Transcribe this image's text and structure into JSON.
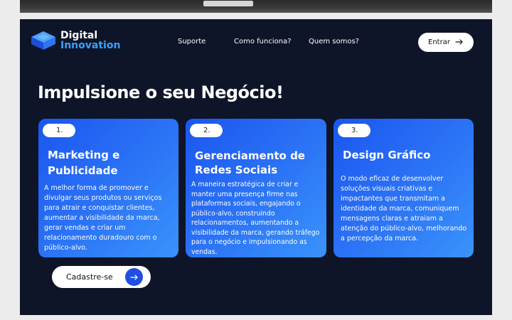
{
  "brand": {
    "line1": "Digital",
    "line2": "Innovation"
  },
  "nav": {
    "suporte": "Suporte",
    "como": "Como funciona?",
    "quem": "Quem somos?"
  },
  "header": {
    "login_label": "Entrar"
  },
  "hero": {
    "title": "Impulsione o seu Negócio!"
  },
  "cards": [
    {
      "number": "1.",
      "title": "Marketing e Publicidade",
      "text": "A melhor forma de promover e divulgar seus produtos ou serviços para atrair e conquistar clientes, aumentar a visibilidade da marca, gerar vendas e criar um relacionamento duradouro com o público-alvo."
    },
    {
      "number": "2.",
      "title": "Gerenciamento de Redes Sociais",
      "text": "A maneira estratégica de criar e manter uma presença firme nas plataformas sociais, engajando o público-alvo, construindo relacionamentos, aumentando a visibilidade da marca, gerando tráfego para o negócio e impulsionando as vendas."
    },
    {
      "number": "3.",
      "title": "Design Gráfico",
      "text": "O modo eficaz de desenvolver soluções visuais criativas e impactantes que transmitam a identidade da marca, comuniquem mensagens claras e atraiam a atenção do público-alvo, melhorando a percepção da marca."
    }
  ],
  "cta": {
    "signup_label": "Cadastre-se"
  },
  "colors": {
    "background": "#0e1528",
    "accent": "#36a2ff",
    "card_start": "#1b56f0",
    "card_end": "#3a93fb",
    "button_circle": "#1f4fe0"
  },
  "icons": {
    "logo": "cube-logo-icon",
    "arrow": "arrow-right-icon"
  }
}
